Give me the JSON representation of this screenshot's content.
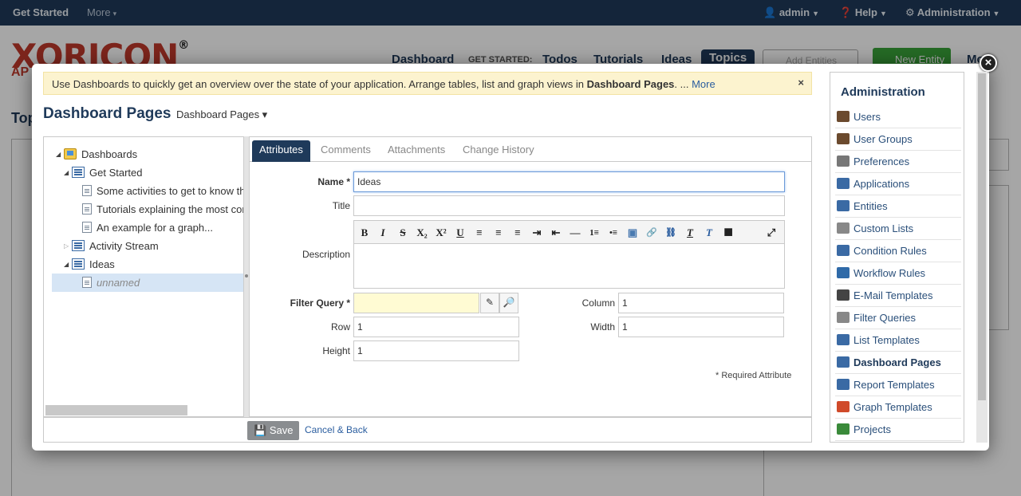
{
  "topbar": {
    "get_started": "Get Started",
    "more": "More",
    "admin": "admin",
    "help": "Help",
    "administration": "Administration"
  },
  "background": {
    "logo": "XORICON",
    "logo_reg": "®",
    "logo_sub": "AP",
    "nav": {
      "dashboard": "Dashboard",
      "get_started_label": "GET STARTED:",
      "todos": "Todos",
      "tutorials": "Tutorials",
      "ideas": "Ideas",
      "topics": "Topics"
    },
    "search_placeholder": "Add Entities",
    "new_entity": "New Entity",
    "more": "Mo",
    "page_title": "Top"
  },
  "notice": {
    "text_before": "Use Dashboards to quickly get an overview over the state of your application. Arrange tables, list and graph views in ",
    "bold": "Dashboard Pages",
    "text_after": ". ... ",
    "more_link": "More",
    "close": "×"
  },
  "page": {
    "title": "Dashboard Pages",
    "dropdown": "Dashboard Pages ▾"
  },
  "tree": {
    "root": "Dashboards",
    "get_started": "Get Started",
    "items": [
      "Some activities to get to know th",
      "Tutorials explaining the most cor",
      "An example for a graph..."
    ],
    "activity_stream": "Activity Stream",
    "ideas": "Ideas",
    "unnamed": "unnamed"
  },
  "tabs": [
    "Attributes",
    "Comments",
    "Attachments",
    "Change History"
  ],
  "form": {
    "name_label": "Name *",
    "name_value": "Ideas",
    "title_label": "Title",
    "title_value": "",
    "description_label": "Description",
    "filter_query_label": "Filter Query *",
    "filter_query_value": "",
    "column_label": "Column",
    "column_value": "1",
    "row_label": "Row",
    "row_value": "1",
    "width_label": "Width",
    "width_value": "1",
    "height_label": "Height",
    "height_value": "1",
    "required_note": "* Required Attribute"
  },
  "rte_toolbar": [
    "B",
    "I",
    "S",
    "X₂",
    "X²",
    "U",
    "≡",
    "≡",
    "≡",
    "⇥",
    "⇤",
    "—",
    "1≡",
    "•≡",
    "▣",
    "🔗",
    "⛓",
    "T",
    "T",
    "■",
    "⤢"
  ],
  "footer": {
    "save": "Save",
    "cancel": "Cancel & Back"
  },
  "admin": {
    "heading": "Administration",
    "items": [
      {
        "label": "Users",
        "icon": "user-icon",
        "color": "#6b4a2e"
      },
      {
        "label": "User Groups",
        "icon": "user-group-icon",
        "color": "#6b4a2e"
      },
      {
        "label": "Preferences",
        "icon": "tools-icon",
        "color": "#777"
      },
      {
        "label": "Applications",
        "icon": "application-icon",
        "color": "#3a6aa4"
      },
      {
        "label": "Entities",
        "icon": "entity-icon",
        "color": "#3a6aa4"
      },
      {
        "label": "Custom Lists",
        "icon": "custom-list-icon",
        "color": "#888"
      },
      {
        "label": "Condition Rules",
        "icon": "condition-rule-icon",
        "color": "#3a6aa4"
      },
      {
        "label": "Workflow Rules",
        "icon": "workflow-icon",
        "color": "#2f6aa8"
      },
      {
        "label": "E-Mail Templates",
        "icon": "email-icon",
        "color": "#444"
      },
      {
        "label": "Filter Queries",
        "icon": "filter-query-icon",
        "color": "#888"
      },
      {
        "label": "List Templates",
        "icon": "list-template-icon",
        "color": "#3a6aa4"
      },
      {
        "label": "Dashboard Pages",
        "icon": "dashboard-icon",
        "color": "#3a6aa4"
      },
      {
        "label": "Report Templates",
        "icon": "report-icon",
        "color": "#3a6aa4"
      },
      {
        "label": "Graph Templates",
        "icon": "graph-icon",
        "color": "#d04a2a"
      },
      {
        "label": "Projects",
        "icon": "project-icon",
        "color": "#3a8a3a"
      }
    ]
  },
  "colors": {
    "brand_navy": "#1f3a5a",
    "notice_bg": "#fcf3cf",
    "selection": "#d6e5f5",
    "required_input": "#fffbd3"
  }
}
